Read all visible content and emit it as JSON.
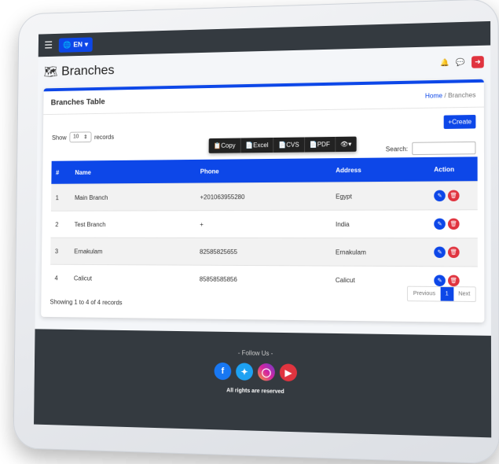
{
  "header": {
    "lang_label": "EN",
    "page_title": "Branches",
    "breadcrumb_home": "Home",
    "breadcrumb_sep": "/",
    "breadcrumb_current": "Branches"
  },
  "card": {
    "title": "Branches Table",
    "create_label": "Create",
    "show_label": "Show",
    "entries_value": "10",
    "records_label": "records",
    "search_label": "Search:",
    "export_buttons": [
      "Copy",
      "Excel",
      "CVS",
      "PDF"
    ],
    "columns": [
      "#",
      "Name",
      "Phone",
      "Address",
      "Action"
    ],
    "rows": [
      {
        "num": "1",
        "name": "Main Branch",
        "phone": "+201063955280",
        "address": "Egypt"
      },
      {
        "num": "2",
        "name": "Test Branch",
        "phone": "+",
        "address": "India"
      },
      {
        "num": "3",
        "name": "Ernakulam",
        "phone": "82585825655",
        "address": "Ernakulam"
      },
      {
        "num": "4",
        "name": "Calicut",
        "phone": "85858585856",
        "address": "Calicut"
      }
    ],
    "showing": "Showing 1 to 4 of 4 records",
    "pager": {
      "prev": "Previous",
      "page": "1",
      "next": "Next"
    }
  },
  "footer": {
    "follow": "- Follow Us -",
    "rights": "All rights are reserved"
  },
  "colors": {
    "accent": "#0d47e8",
    "danger": "#e0343f",
    "dark": "#343a40"
  }
}
